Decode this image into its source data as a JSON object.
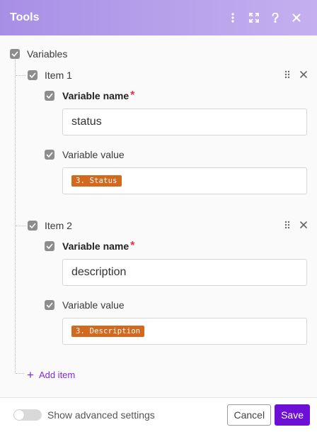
{
  "header": {
    "title": "Tools",
    "icons": [
      "more-vertical-icon",
      "expand-icon",
      "help-icon",
      "close-icon"
    ]
  },
  "variables": {
    "label": "Variables",
    "items": [
      {
        "title": "Item 1",
        "name_label": "Variable name",
        "name_required": "*",
        "name_value": "status",
        "value_label": "Variable value",
        "value_pill": "3. Status"
      },
      {
        "title": "Item 2",
        "name_label": "Variable name",
        "name_required": "*",
        "name_value": "description",
        "value_label": "Variable value",
        "value_pill": "3. Description"
      }
    ],
    "add_item_label": "Add item"
  },
  "footer": {
    "advanced_label": "Show advanced settings",
    "advanced_enabled": false,
    "cancel_label": "Cancel",
    "save_label": "Save"
  },
  "colors": {
    "header_start": "#a88fe6",
    "header_end": "#c4b0ef",
    "pill": "#d2691e",
    "accent": "#6d10d6",
    "link": "#7a2dd6",
    "required": "#e0354b"
  }
}
